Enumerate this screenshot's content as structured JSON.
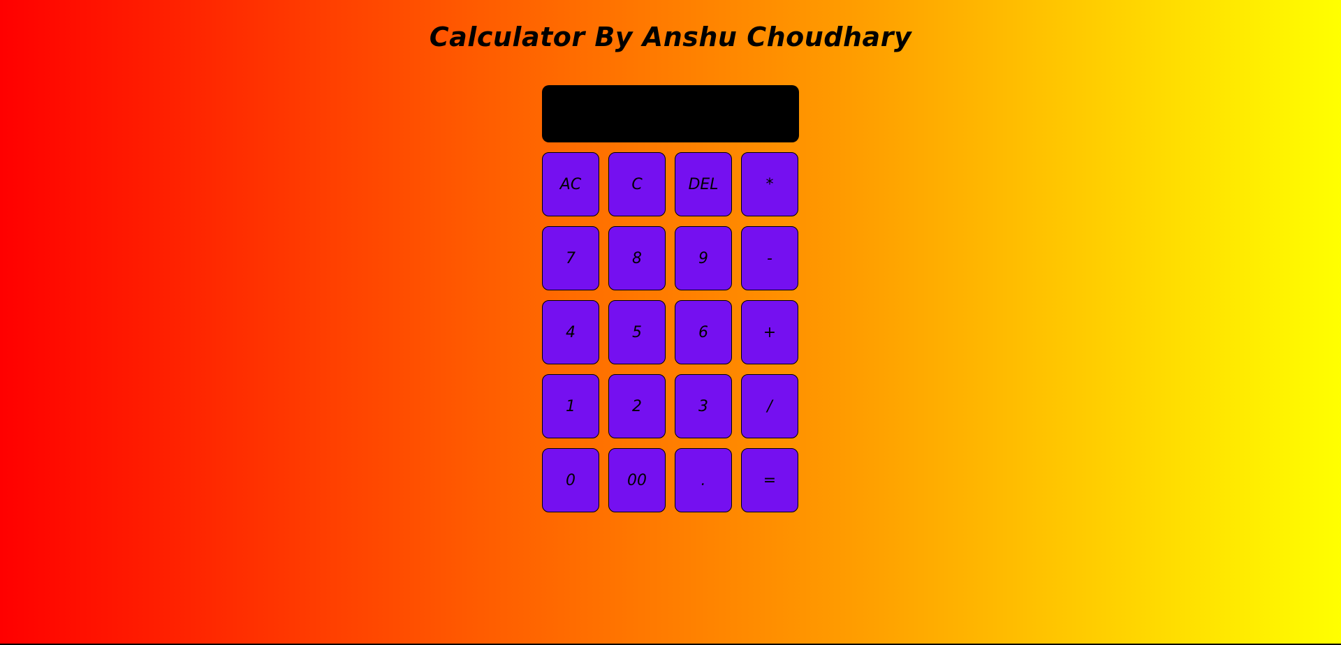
{
  "title": "Calculator By Anshu Choudhary",
  "display": {
    "value": ""
  },
  "keys": {
    "rows": [
      [
        "AC",
        "C",
        "DEL",
        "*"
      ],
      [
        "7",
        "8",
        "9",
        "-"
      ],
      [
        "4",
        "5",
        "6",
        "+"
      ],
      [
        "1",
        "2",
        "3",
        "/"
      ],
      [
        "0",
        "00",
        ".",
        "="
      ]
    ]
  },
  "colors": {
    "background_start": "#ff0000",
    "background_end": "#ffff00",
    "key_fill": "#7510f0",
    "display_fill": "#000000"
  }
}
